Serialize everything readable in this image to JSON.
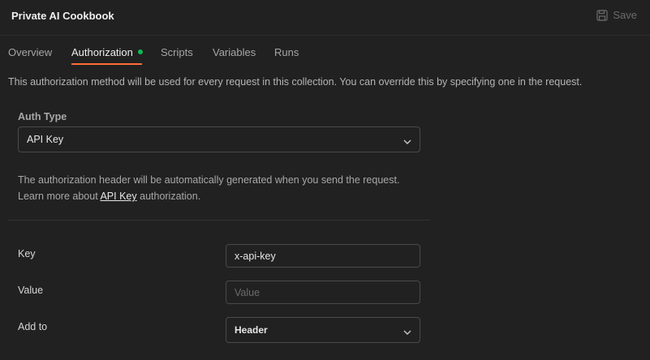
{
  "header": {
    "title": "Private AI Cookbook",
    "save_label": "Save"
  },
  "tabs": [
    {
      "label": "Overview"
    },
    {
      "label": "Authorization",
      "indicator": "green-dot"
    },
    {
      "label": "Scripts"
    },
    {
      "label": "Variables"
    },
    {
      "label": "Runs"
    }
  ],
  "info_text": "This authorization method will be used for every request in this collection. You can override this by specifying one in the request.",
  "auth": {
    "type_label": "Auth Type",
    "type_value": "API Key",
    "desc_line1": "The authorization header will be automatically generated when you send the request.",
    "desc_line2_pre": "Learn more about ",
    "desc_link": "API Key",
    "desc_line2_post": " authorization."
  },
  "fields": {
    "key_label": "Key",
    "key_value": "x-api-key",
    "value_label": "Value",
    "value_placeholder": "Value",
    "add_to_label": "Add to",
    "add_to_value": "Header"
  },
  "colors": {
    "accent_underline": "#ff6c37",
    "indicator_dot": "#0cbb52",
    "background": "#212121"
  }
}
